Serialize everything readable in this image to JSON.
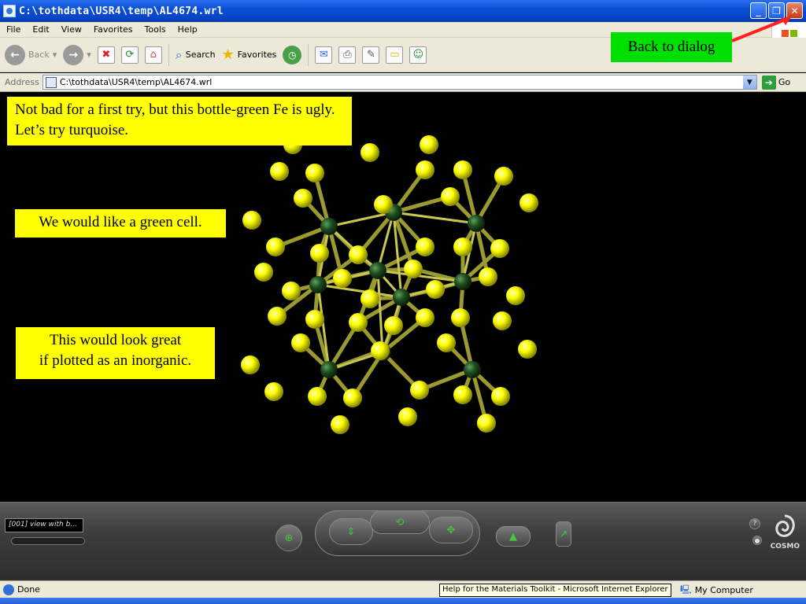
{
  "window": {
    "title": "C:\\tothdata\\USR4\\temp\\AL4674.wrl",
    "minimize": "_",
    "maximize": "❐",
    "close": "✕"
  },
  "menu": [
    "File",
    "Edit",
    "View",
    "Favorites",
    "Tools",
    "Help"
  ],
  "toolbar": {
    "back": "Back",
    "search": "Search",
    "favorites": "Favorites"
  },
  "address": {
    "label": "Address",
    "value": "C:\\tothdata\\USR4\\temp\\AL4674.wrl",
    "go": "Go"
  },
  "notes": {
    "note1": "Not bad for a first try, but this bottle-green Fe is ugly. Let’s try turquoise.",
    "note2": "We would like a green cell.",
    "note3_line1": "This would look great",
    "note3_line2": "if plotted as an inorganic.",
    "callout": "Back to dialog"
  },
  "cosmo": {
    "viewpoint": "[001] view with b...",
    "logo": "COSMO"
  },
  "status": {
    "text": "Done",
    "tooltip": "Help for the Materials Toolkit - Microsoft Internet Explorer",
    "zone": "My Computer"
  },
  "colors": {
    "atom_yellow": "#ffff00",
    "atom_green": "#1e4d1e",
    "bond": "#9a9a30",
    "callout_green": "#00e000",
    "arrow_red": "#ff2020"
  }
}
